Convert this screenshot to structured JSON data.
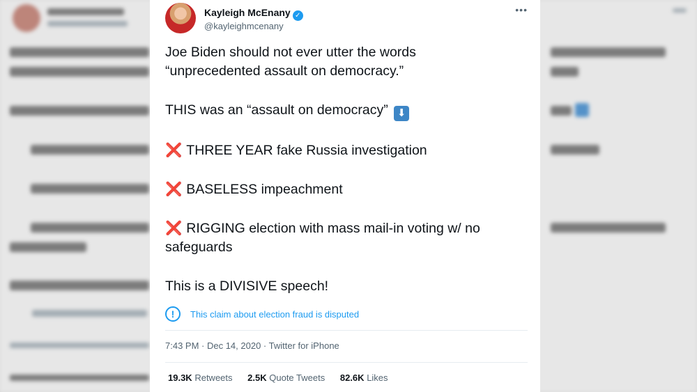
{
  "tweet": {
    "author_name": "Kayleigh McEnany",
    "verified_glyph": "✓",
    "handle": "@kayleighmcenany",
    "more_glyph": "•••",
    "lines": {
      "l1": "Joe Biden should not ever utter the words",
      "l2": "“unprecedented assault on democracy.”",
      "l3": "THIS was an “assault on democracy”",
      "l3_arrow": "⬇",
      "x": "❌",
      "l4": "THREE YEAR fake Russia investigation",
      "l5": "BASELESS impeachment",
      "l6a": "RIGGING election with mass mail-in voting w/ no",
      "l6b": "safeguards",
      "l7": "This is a DIVISIVE speech!"
    },
    "disputed_icon": "!",
    "disputed_text": "This claim about election fraud is disputed",
    "meta": "7:43 PM · Dec 14, 2020 · Twitter for iPhone",
    "stats": {
      "retweets_count": "19.3K",
      "retweets_label": "Retweets",
      "quotes_count": "2.5K",
      "quotes_label": "Quote Tweets",
      "likes_count": "82.6K",
      "likes_label": "Likes"
    }
  },
  "colors": {
    "accent": "#1d9bf0",
    "x_red": "#d52a2a",
    "text": "#0f1419",
    "muted": "#536471"
  },
  "icons": {
    "verified": "verified-badge-icon",
    "more": "more-options-icon",
    "disputed": "info-circle-icon",
    "arrow": "down-arrow-emoji-icon",
    "x": "cross-mark-emoji-icon"
  }
}
